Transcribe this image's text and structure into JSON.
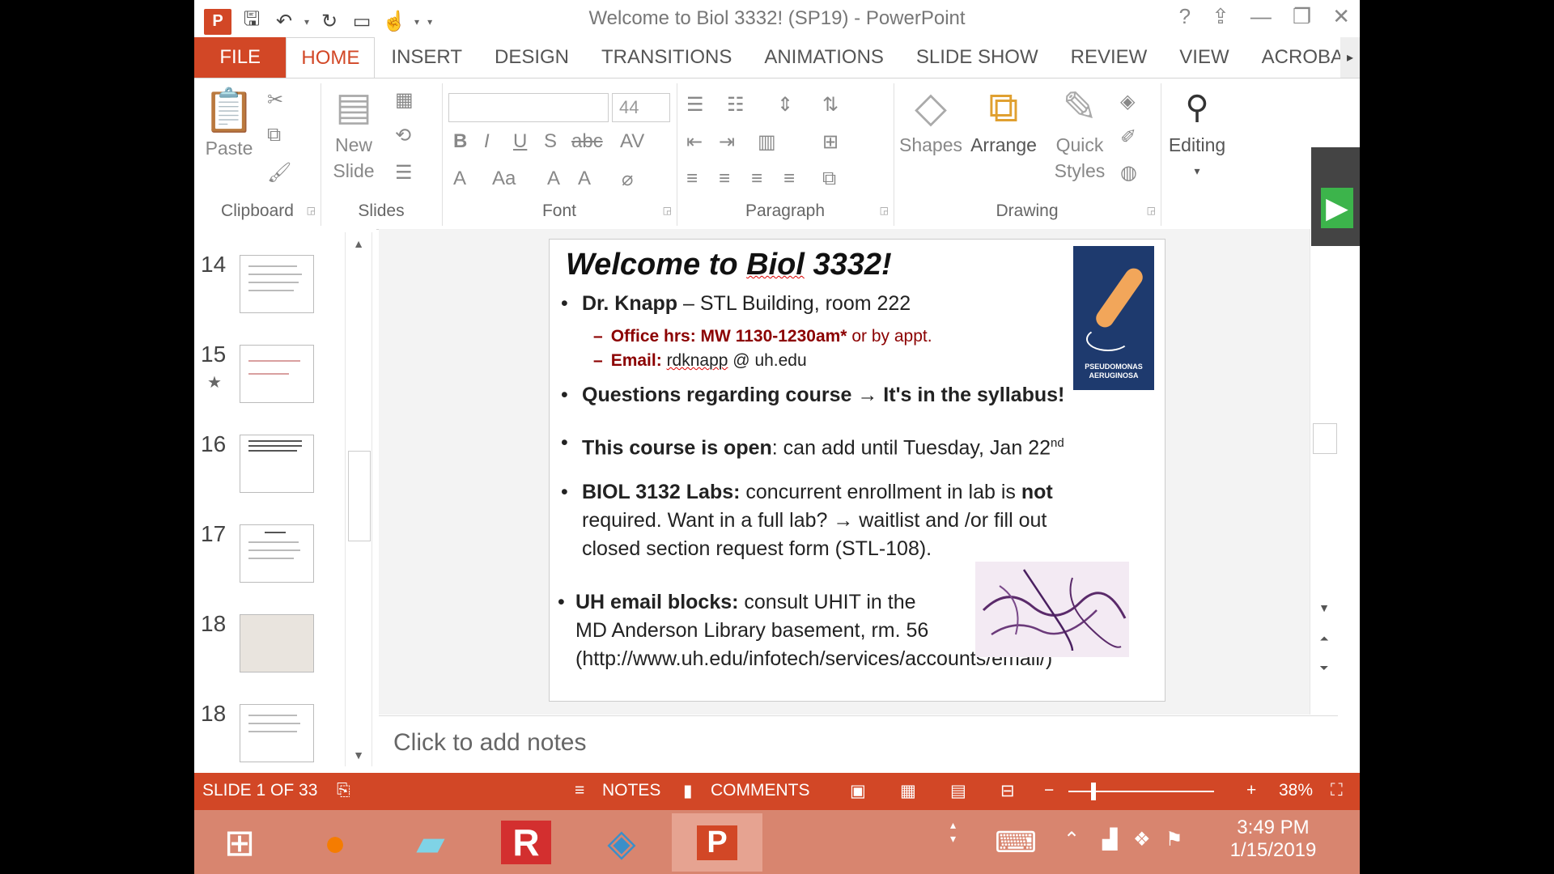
{
  "window": {
    "title": "Welcome to Biol 3332! (SP19) - PowerPoint",
    "app_icon": "P",
    "controls": [
      "?",
      "⇪",
      "—",
      "❐",
      "✕"
    ]
  },
  "tabs": [
    {
      "label": "FILE"
    },
    {
      "label": "HOME"
    },
    {
      "label": "INSERT"
    },
    {
      "label": "DESIGN"
    },
    {
      "label": "TRANSITIONS"
    },
    {
      "label": "ANIMATIONS"
    },
    {
      "label": "SLIDE SHOW"
    },
    {
      "label": "REVIEW"
    },
    {
      "label": "VIEW"
    },
    {
      "label": "ACROBA"
    }
  ],
  "ribbon": {
    "clipboard": {
      "label": "Clipboard",
      "paste": "Paste"
    },
    "slides": {
      "label": "Slides",
      "new_slide_1": "New",
      "new_slide_2": "Slide"
    },
    "font": {
      "label": "Font",
      "font_name": "",
      "font_size": "44"
    },
    "paragraph": {
      "label": "Paragraph"
    },
    "drawing": {
      "label": "Drawing",
      "shapes": "Shapes",
      "arrange": "Arrange",
      "quick_styles_1": "Quick",
      "quick_styles_2": "Styles"
    },
    "editing": {
      "label": "Editing"
    }
  },
  "thumbnails": [
    {
      "num": "14",
      "star": ""
    },
    {
      "num": "15",
      "star": "★"
    },
    {
      "num": "16",
      "star": ""
    },
    {
      "num": "17",
      "star": ""
    },
    {
      "num": "18",
      "star": ""
    },
    {
      "num": "18",
      "star": ""
    }
  ],
  "slide": {
    "title_pre": "Welcome to ",
    "title_u": "Biol",
    "title_post": " 3332!",
    "logo_text": "PSEUDOMONAS AERUGINOSA",
    "b1_bold": "Dr. Knapp",
    "b1_rest": " – STL Building, room 222",
    "b1_sub1_bold": "Office hrs:  MW 1130-1230am*",
    "b1_sub1_rest": " or by appt.",
    "b1_sub2_bold": "Email:",
    "b1_sub2_link": "rdknapp",
    "b1_sub2_rest": " @ uh.edu",
    "b2": "Questions regarding course → It's in the syllabus!",
    "b3_bold": "This course is open",
    "b3_rest": ": can add until Tuesday, Jan 22",
    "b3_sup": "nd",
    "b4_bold": "BIOL 3132 Labs:",
    "b4_mid": " concurrent enrollment in lab is ",
    "b4_not": "not",
    "b4_l2": "required.  Want in a full lab? → waitlist and /or fill out",
    "b4_l3": "closed section request form (STL-108).",
    "b5_bold": "UH email blocks:",
    "b5_rest": "  consult UHIT in the",
    "b5_l2": "MD Anderson Library basement, rm. 56",
    "b5_l3": "(http://www.uh.edu/infotech/services/accounts/email/)",
    "bullet": "•",
    "dash": "–"
  },
  "notes": {
    "placeholder": "Click to add notes"
  },
  "status": {
    "slide_info": "SLIDE 1 OF 33",
    "notes": "NOTES",
    "comments": "COMMENTS",
    "zoom": "38%",
    "zoom_level_fraction": 0.38
  },
  "taskbar": {
    "time": "3:49 PM",
    "date": "1/15/2019"
  },
  "colors": {
    "accent": "#d24726",
    "taskbar": "#d8856f"
  }
}
